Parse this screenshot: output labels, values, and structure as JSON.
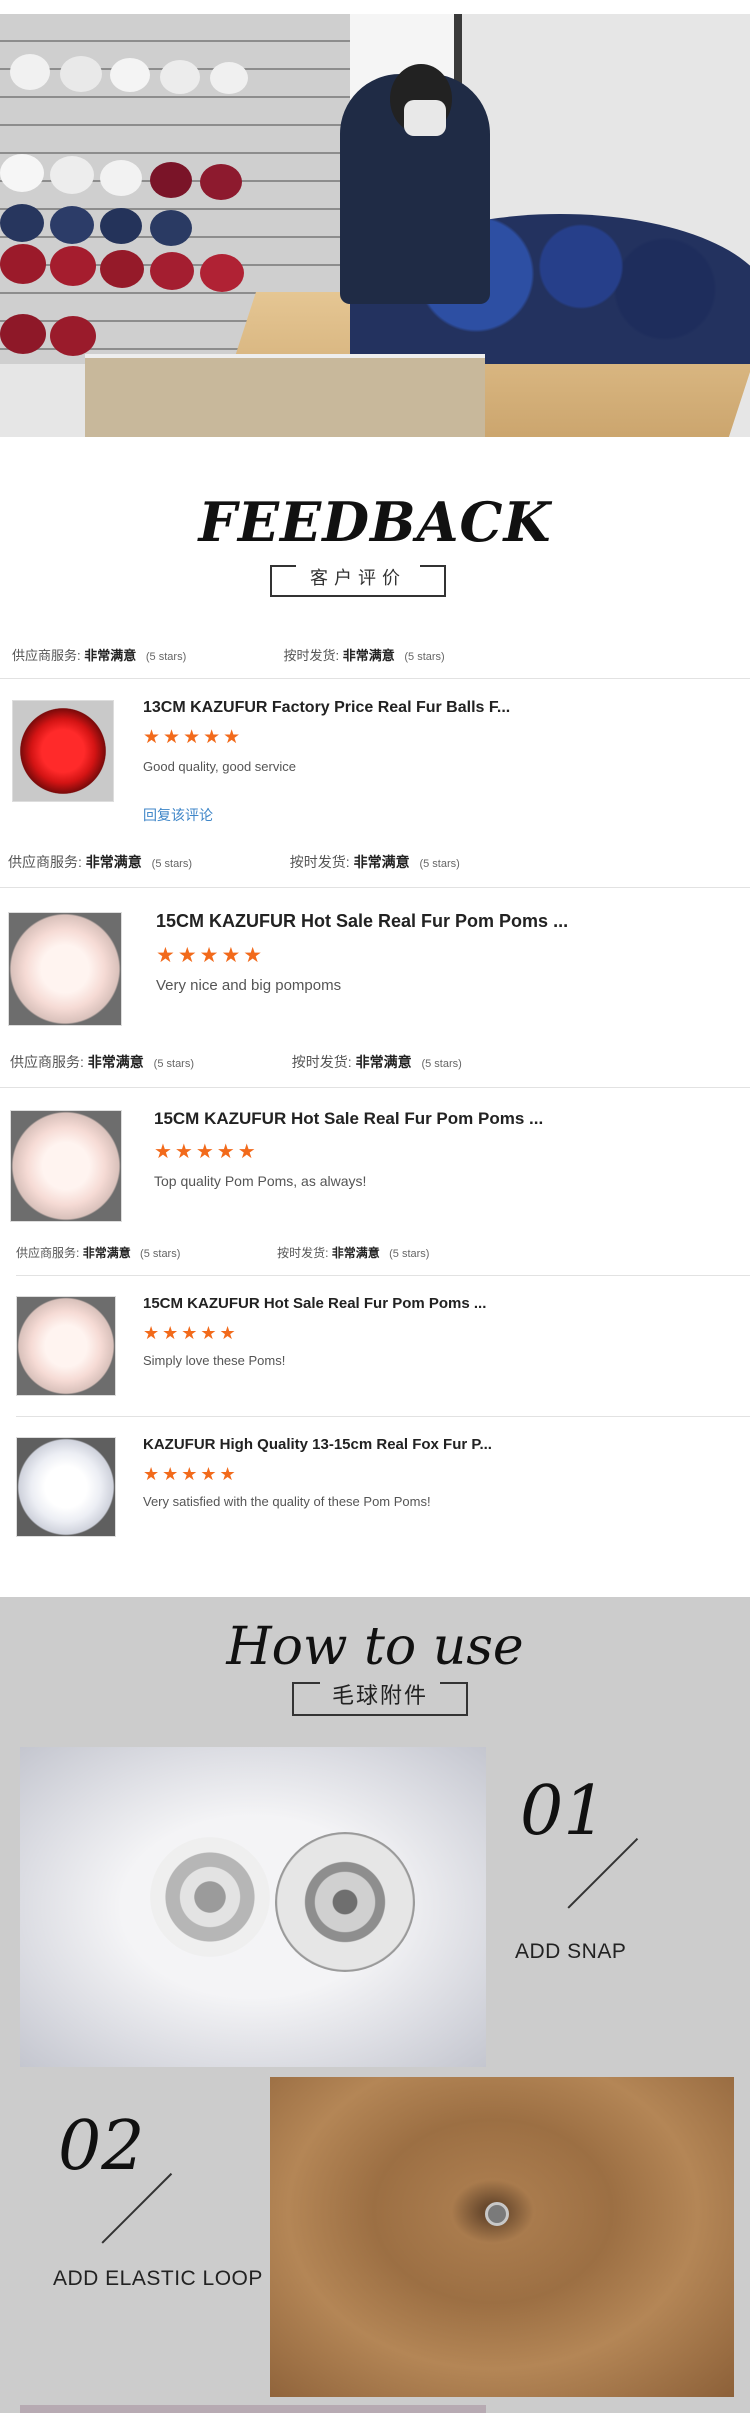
{
  "feedback": {
    "title": "FEEDBACK",
    "subtitle": "客户评价",
    "reviews": [
      {
        "supplier_label": "供应商服务:",
        "supplier_value": "非常满意",
        "supplier_stars": "(5 stars)",
        "ship_label": "按时发货:",
        "ship_value": "非常满意",
        "ship_stars": "(5 stars)",
        "title": "13CM KAZUFUR Factory Price Real Fur Balls F...",
        "stars": "★★★★★",
        "comment": "Good quality, good service",
        "reply": "回复该评论",
        "thumb_color": "#d41414"
      },
      {
        "supplier_label": "供应商服务:",
        "supplier_value": "非常满意",
        "supplier_stars": "(5 stars)",
        "ship_label": "按时发货:",
        "ship_value": "非常满意",
        "ship_stars": "(5 stars)",
        "title": "15CM KAZUFUR Hot Sale Real Fur Pom Poms ...",
        "stars": "★★★★★",
        "comment": "Very nice and big pompoms",
        "thumb_color": "#f6dbd5"
      },
      {
        "supplier_label": "供应商服务:",
        "supplier_value": "非常满意",
        "supplier_stars": "(5 stars)",
        "ship_label": "按时发货:",
        "ship_value": "非常满意",
        "ship_stars": "(5 stars)",
        "title": "15CM KAZUFUR Hot Sale Real Fur Pom Poms ...",
        "stars": "★★★★★",
        "comment": "Top quality Pom Poms, as always!",
        "thumb_color": "#f6dbd5"
      },
      {
        "supplier_label": "供应商服务:",
        "supplier_value": "非常满意",
        "supplier_stars": "(5 stars)",
        "ship_label": "按时发货:",
        "ship_value": "非常满意",
        "ship_stars": "(5 stars)",
        "title": "15CM KAZUFUR Hot Sale Real Fur Pom Poms ...",
        "stars": "★★★★★",
        "comment": "Simply love these Poms!",
        "thumb_color": "#f6dbd5"
      },
      {
        "title": "KAZUFUR High Quality 13-15cm Real Fox Fur P...",
        "stars": "★★★★★",
        "comment": "Very satisfied with the quality of these Pom Poms!",
        "thumb_color": "#eceef4"
      }
    ]
  },
  "howto": {
    "title": "How to use",
    "subtitle": "毛球附件",
    "steps": [
      {
        "number": "01",
        "label": "ADD SNAP"
      },
      {
        "number": "02",
        "label": "ADD ELASTIC LOOP"
      }
    ]
  },
  "colors": {
    "star": "#f26a1b",
    "link": "#3f86c8",
    "howto_bg": "#cccccc"
  }
}
